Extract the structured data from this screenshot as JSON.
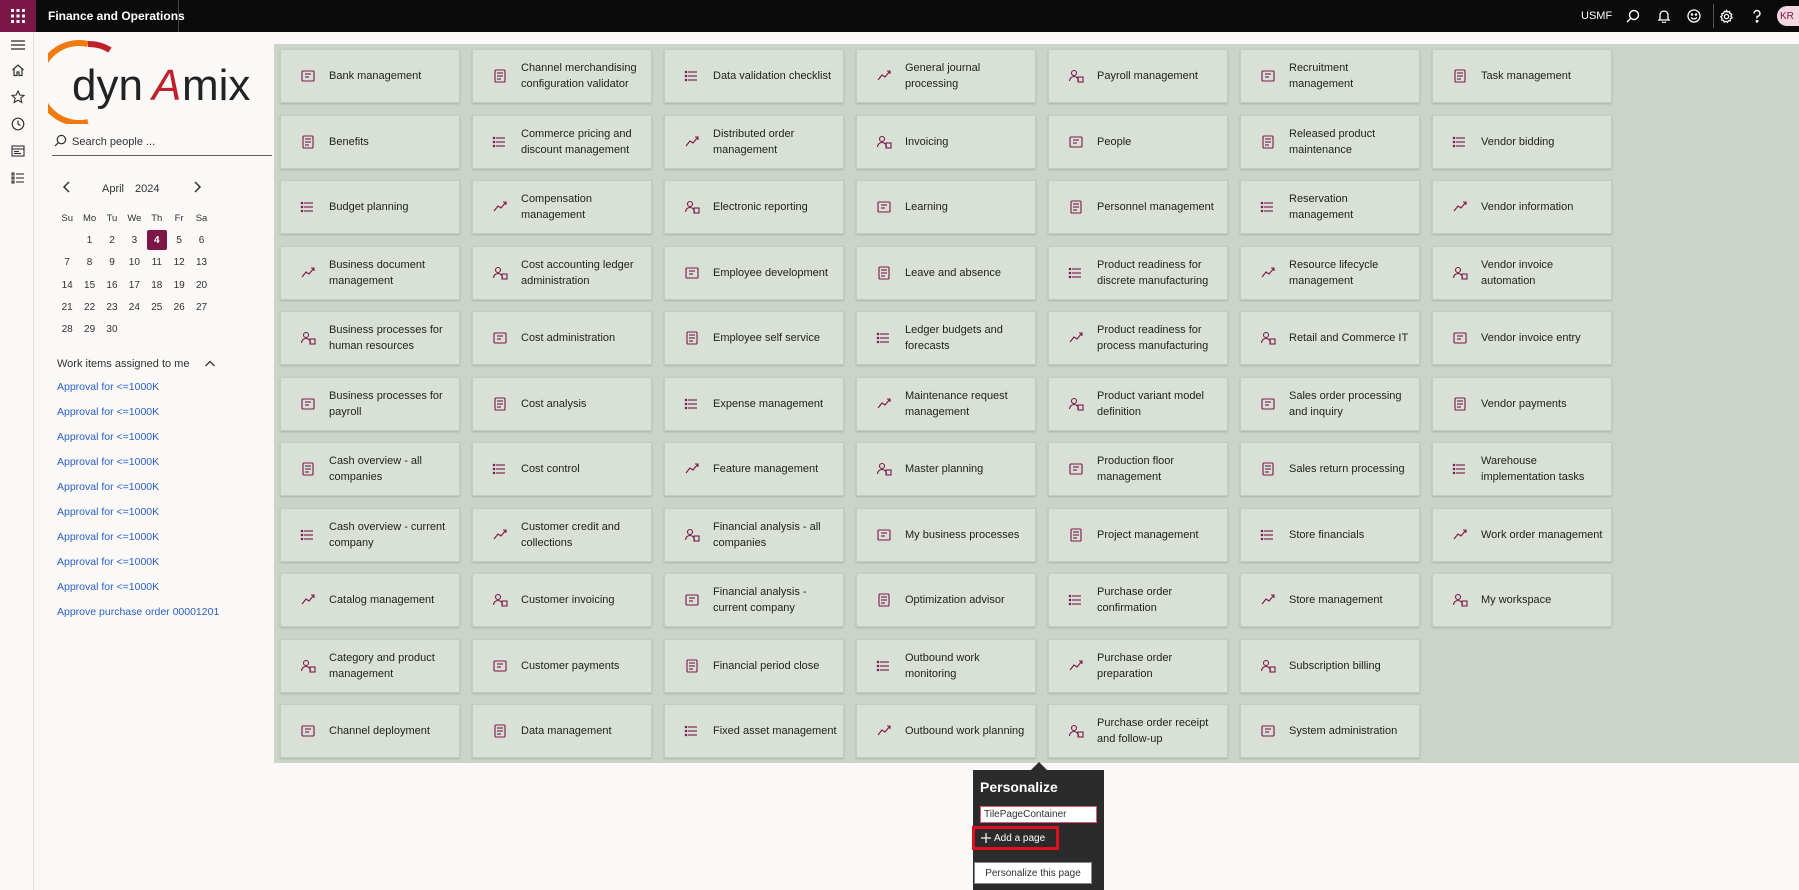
{
  "topbar": {
    "app_title": "Finance and Operations",
    "company": "USMF",
    "user_initials": "KR",
    "icons": [
      "waffle-icon",
      "search-icon",
      "bell-icon",
      "smiley-icon",
      "gear-icon",
      "help-icon"
    ]
  },
  "navrail": {
    "icons": [
      "hamburger-icon",
      "home-icon",
      "star-icon",
      "clock-icon",
      "workspaces-icon",
      "modules-icon"
    ]
  },
  "logo": {
    "text_left": "dyn",
    "text_a": "A",
    "text_right": "mix"
  },
  "search": {
    "placeholder": "Search people ..."
  },
  "calendar": {
    "month": "April",
    "year": "2024",
    "weekdays": [
      "Su",
      "Mo",
      "Tu",
      "We",
      "Th",
      "Fr",
      "Sa"
    ],
    "weeks": [
      [
        "",
        "1",
        "2",
        "3",
        "4",
        "5",
        "6"
      ],
      [
        "7",
        "8",
        "9",
        "10",
        "11",
        "12",
        "13"
      ],
      [
        "14",
        "15",
        "16",
        "17",
        "18",
        "19",
        "20"
      ],
      [
        "21",
        "22",
        "23",
        "24",
        "25",
        "26",
        "27"
      ],
      [
        "28",
        "29",
        "30",
        "",
        "",
        "",
        ""
      ]
    ],
    "today": "4"
  },
  "work_items": {
    "title": "Work items assigned to me",
    "items": [
      "Approval for <=1000K",
      "Approval for <=1000K",
      "Approval for <=1000K",
      "Approval for <=1000K",
      "Approval for <=1000K",
      "Approval for <=1000K",
      "Approval for <=1000K",
      "Approval for <=1000K",
      "Approval for <=1000K",
      "Approve purchase order 00001201"
    ]
  },
  "tiles": {
    "columns": [
      [
        "Bank management",
        "Benefits",
        "Budget planning",
        "Business document management",
        "Business processes for human resources",
        "Business processes for payroll",
        "Cash overview - all companies",
        "Cash overview - current company",
        "Catalog management",
        "Category and product management",
        "Channel deployment"
      ],
      [
        "Channel merchandising configuration validator",
        "Commerce pricing and discount management",
        "Compensation management",
        "Cost accounting ledger administration",
        "Cost administration",
        "Cost analysis",
        "Cost control",
        "Customer credit and collections",
        "Customer invoicing",
        "Customer payments",
        "Data management"
      ],
      [
        "Data validation checklist",
        "Distributed order management",
        "Electronic reporting",
        "Employee development",
        "Employee self service",
        "Expense management",
        "Feature management",
        "Financial analysis - all companies",
        "Financial analysis - current company",
        "Financial period close",
        "Fixed asset management"
      ],
      [
        "General journal processing",
        "Invoicing",
        "Learning",
        "Leave and absence",
        "Ledger budgets and forecasts",
        "Maintenance request management",
        "Master planning",
        "My business processes",
        "Optimization advisor",
        "Outbound work monitoring",
        "Outbound work planning"
      ],
      [
        "Payroll management",
        "People",
        "Personnel management",
        "Product readiness for discrete manufacturing",
        "Product readiness for process manufacturing",
        "Product variant model definition",
        "Production floor management",
        "Project management",
        "Purchase order confirmation",
        "Purchase order preparation",
        "Purchase order receipt and follow-up"
      ],
      [
        "Recruitment management",
        "Released product maintenance",
        "Reservation management",
        "Resource lifecycle management",
        "Retail and Commerce IT",
        "Sales order processing and inquiry",
        "Sales return processing",
        "Store financials",
        "Store management",
        "Subscription billing",
        "System administration"
      ],
      [
        "Task management",
        "Vendor bidding",
        "Vendor information",
        "Vendor invoice automation",
        "Vendor invoice entry",
        "Vendor payments",
        "Warehouse implementation tasks",
        "Work order management",
        "My workspace"
      ]
    ]
  },
  "personalize": {
    "title": "Personalize",
    "container_name": "TilePageContainer",
    "add_page_label": "Add a page",
    "personalize_page_label": "Personalize this page"
  },
  "colors": {
    "brand": "#7a1747",
    "tile_bg": "#d9e0d6",
    "tile_area_bg": "#cbd4c8",
    "link": "#2b5ec5"
  }
}
